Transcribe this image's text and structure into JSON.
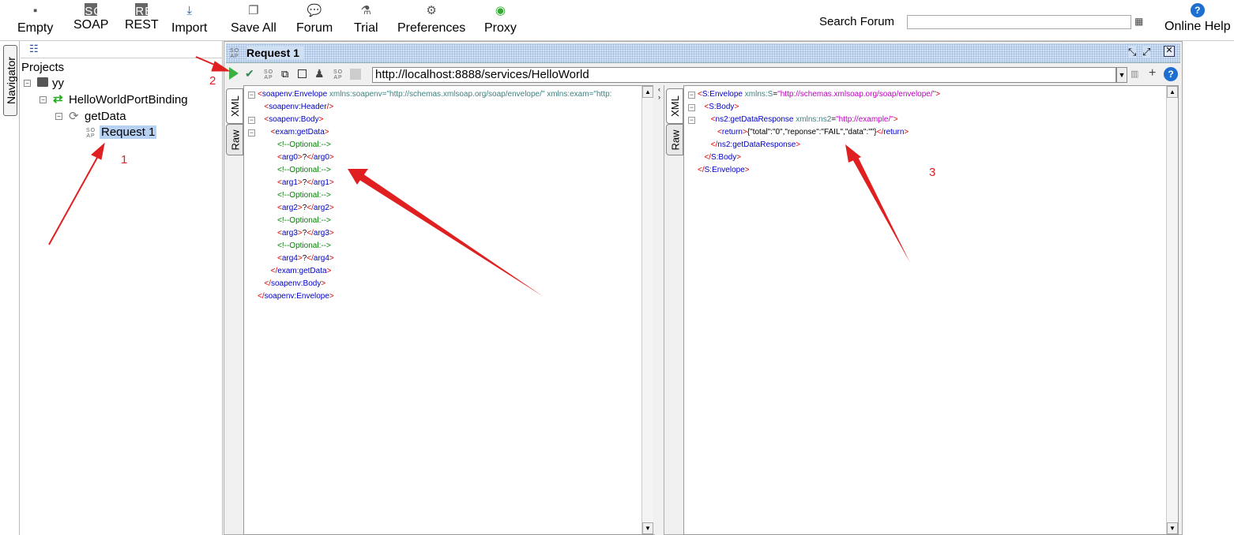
{
  "toolbar": {
    "items": [
      {
        "label": "Empty",
        "icon": "empty-project-icon"
      },
      {
        "label": "SOAP",
        "icon": "soap-icon"
      },
      {
        "label": "REST",
        "icon": "rest-icon"
      },
      {
        "label": "Import",
        "icon": "import-icon"
      },
      {
        "label": "Save All",
        "icon": "save-all-icon"
      },
      {
        "label": "Forum",
        "icon": "forum-icon"
      },
      {
        "label": "Trial",
        "icon": "trial-icon"
      },
      {
        "label": "Preferences",
        "icon": "gear-icon"
      },
      {
        "label": "Proxy",
        "icon": "proxy-icon"
      }
    ],
    "search_label": "Search Forum",
    "search_value": "",
    "online_help": "Online Help"
  },
  "navigator": {
    "tab_label": "Navigator",
    "root": "Projects",
    "project": "yy",
    "binding": "HelloWorldPortBinding",
    "operation": "getData",
    "request": "Request 1"
  },
  "request": {
    "title": "Request 1",
    "soap_badge": "SO AP",
    "url": "http://localhost:8888/services/HelloWorld",
    "tabs": [
      "XML",
      "Raw"
    ],
    "request_xml": [
      "<soapenv:Envelope xmlns:soapenv=\"http://schemas.xmlsoap.org/soap/envelope/\" xmlns:exam=\"http:",
      "   <soapenv:Header/>",
      "   <soapenv:Body>",
      "      <exam:getData>",
      "         <!--Optional:-->",
      "         <arg0>?</arg0>",
      "         <!--Optional:-->",
      "         <arg1>?</arg1>",
      "         <!--Optional:-->",
      "         <arg2>?</arg2>",
      "         <!--Optional:-->",
      "         <arg3>?</arg3>",
      "         <!--Optional:-->",
      "         <arg4>?</arg4>",
      "      </exam:getData>",
      "   </soapenv:Body>",
      "</soapenv:Envelope>"
    ],
    "response_xml": [
      "<S:Envelope xmlns:S=\"http://schemas.xmlsoap.org/soap/envelope/\">",
      "   <S:Body>",
      "      <ns2:getDataResponse xmlns:ns2=\"http://example/\">",
      "         <return>{\"total\":\"0\",\"reponse\":\"FAIL\",\"data\":\"\"}</return>",
      "      </ns2:getDataResponse>",
      "   </S:Body>",
      "</S:Envelope>"
    ]
  },
  "annotations": {
    "one": "1",
    "two": "2",
    "three": "3",
    "color": "#e02020"
  },
  "colors": {
    "bracket": "#e00000",
    "tag": "#0000c8",
    "attr": "#3f8080",
    "value": "#c000c0",
    "comment": "#008000",
    "run": "#3cb043"
  }
}
